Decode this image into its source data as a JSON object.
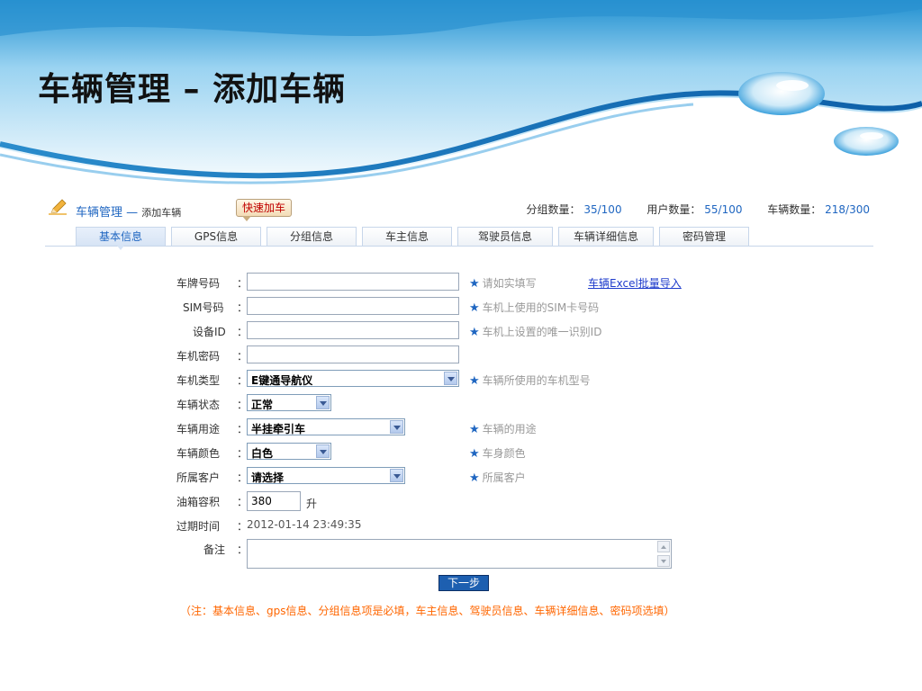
{
  "slide_title": "车辆管理 – 添加车辆",
  "header": {
    "crumb_main": "车辆管理",
    "crumb_dash": "—",
    "crumb_sub": "添加车辆",
    "quick_add": "快速加车",
    "stats": {
      "group_label": "分组数量：",
      "group_value": "35/100",
      "user_label": "用户数量：",
      "user_value": "55/100",
      "vehicle_label": "车辆数量：",
      "vehicle_value": "218/300"
    }
  },
  "tabs": [
    "基本信息",
    "GPS信息",
    "分组信息",
    "车主信息",
    "驾驶员信息",
    "车辆详细信息",
    "密码管理"
  ],
  "form": {
    "plate": {
      "label": "车牌号码",
      "value": "",
      "hint": "请如实填写"
    },
    "excel_link": "车辆Excel批量导入",
    "sim": {
      "label": "SIM号码",
      "value": "",
      "hint": "车机上使用的SIM卡号码"
    },
    "device_id": {
      "label": "设备ID",
      "value": "",
      "hint": "车机上设置的唯一识别ID"
    },
    "device_pwd": {
      "label": "车机密码",
      "value": ""
    },
    "device_type": {
      "label": "车机类型",
      "value": "E键通导航仪",
      "hint": "车辆所使用的车机型号"
    },
    "status": {
      "label": "车辆状态",
      "value": "正常"
    },
    "usage": {
      "label": "车辆用途",
      "value": "半挂牵引车",
      "hint": "车辆的用途"
    },
    "color": {
      "label": "车辆颜色",
      "value": "白色",
      "hint": "车身颜色"
    },
    "customer": {
      "label": "所属客户",
      "value": "请选择",
      "hint": "所属客户"
    },
    "tank": {
      "label": "油箱容积",
      "value": "380",
      "unit": "升"
    },
    "expire": {
      "label": "过期时间",
      "value": "2012-01-14 23:49:35"
    },
    "remark": {
      "label": "备注",
      "value": ""
    },
    "colon": "：",
    "hint_star": "★"
  },
  "next_button": "下一步",
  "note": "（注：基本信息、gps信息、分组信息项是必填，车主信息、驾驶员信息、车辆详细信息、密码项选填）",
  "colors": {
    "accent": "#1f66c1",
    "note": "#ff6600",
    "button": "#1d5fb0"
  }
}
